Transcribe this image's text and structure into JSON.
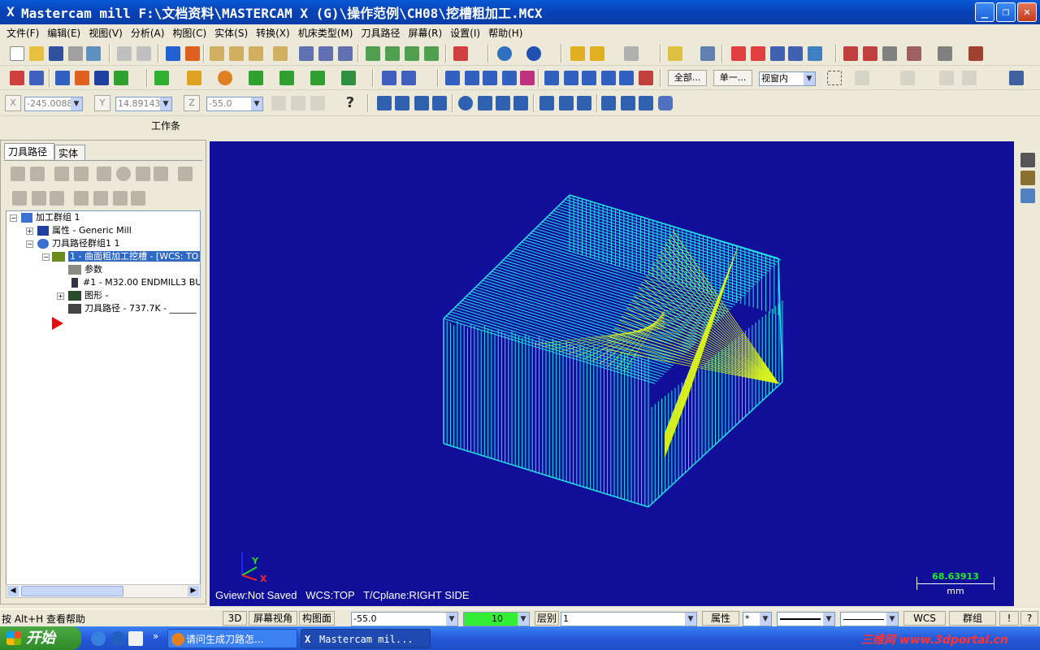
{
  "window": {
    "title": "Mastercam mill  F:\\文档资料\\MASTERCAM X (G)\\操作范例\\CH08\\挖槽粗加工.MCX"
  },
  "menu": [
    "文件(F)",
    "编辑(E)",
    "视图(V)",
    "分析(A)",
    "构图(C)",
    "实体(S)",
    "转换(X)",
    "机床类型(M)",
    "刀具路径",
    "屏幕(R)",
    "设置(I)",
    "帮助(H)"
  ],
  "toolbar2": {
    "all_btn": "全部...",
    "single_btn": "单一...",
    "select_mode": "视窗内"
  },
  "coords": {
    "x_label": "X",
    "x_value": "-245.0088",
    "y_label": "Y",
    "y_value": "14.89143",
    "z_label": "Z",
    "z_value": "-55.0"
  },
  "workbar": "工作条",
  "panel": {
    "tabs": [
      "刀具路径",
      "实体"
    ]
  },
  "tree": {
    "root": "加工群组 1",
    "props": "属性 - Generic Mill",
    "group": "刀具路径群组1 1",
    "op": "1 - 曲面粗加工挖槽 - [WCS: TO",
    "params": "参数",
    "tool": "#1 - M32.00 ENDMILL3 BUL",
    "geom": "图形 -",
    "path": "刀具路径 - 737.7K - ______"
  },
  "viewport": {
    "status": "Gview:Not Saved   WCS:TOP   T/Cplane:RIGHT SIDE",
    "scale_value": "68.63913",
    "scale_unit": "mm",
    "axis_x": "X",
    "axis_y": "Y"
  },
  "status": {
    "help": "按 Alt+H 查看帮助",
    "btn_3d": "3D",
    "screen_view": "屏幕视角",
    "plane": "构图面",
    "z_depth": "-55.0",
    "color": "10",
    "level_label": "层别",
    "level_value": "1",
    "attr": "属性",
    "wcs": "WCS",
    "group": "群组",
    "bang": "!",
    "q": "?"
  },
  "taskbar": {
    "start": "开始",
    "tasks": [
      "请问生成刀路怎...",
      "Mastercam mil..."
    ],
    "watermark": "三维网 www.3dportal.cn"
  },
  "colors": {
    "viewport_bg": "#0f0f99",
    "toolpath": "#22e0e6",
    "toolpath_hi": "#d8f21e",
    "color_swatch": "#33ee33"
  }
}
